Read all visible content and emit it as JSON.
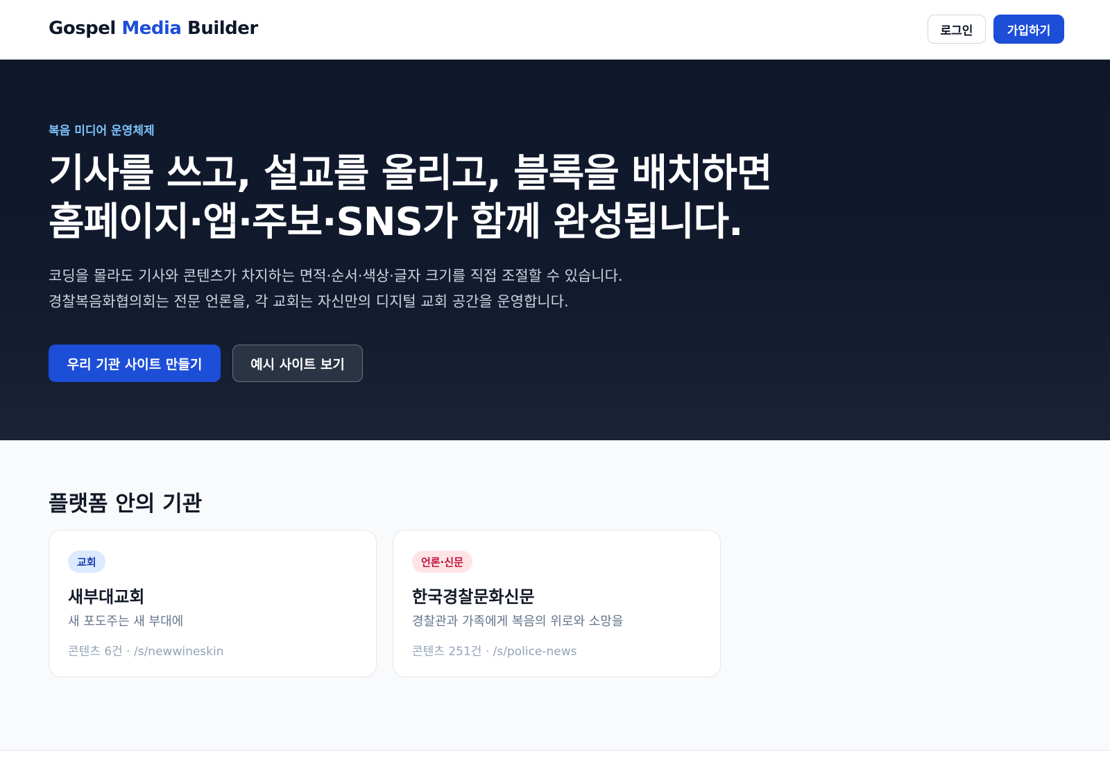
{
  "header": {
    "logo": {
      "part1": "Gospel ",
      "part2": "Media",
      "part3": " Builder"
    },
    "login_label": "로그인",
    "signup_label": "가입하기"
  },
  "hero": {
    "eyebrow": "복음 미디어 운영체제",
    "title_line1": "기사를 쓰고, 설교를 올리고, 블록을 배치하면",
    "title_line2": "홈페이지·앱·주보·SNS가 함께 완성됩니다.",
    "subtitle_line1": "코딩을 몰라도 기사와 콘텐츠가 차지하는 면적·순서·색상·글자 크기를 직접 조절할 수 있습니다.",
    "subtitle_line2": "경찰복음화협의회는 전문 언론을, 각 교회는 자신만의 디지털 교회 공간을 운영합니다.",
    "primary_cta": "우리 기관 사이트 만들기",
    "secondary_cta": "예시 사이트 보기"
  },
  "orgs": {
    "title": "플랫폼 안의 기관",
    "cards": [
      {
        "badge": "교회",
        "name": "새부대교회",
        "description": "새 포도주는 새 부대에",
        "meta": "콘텐츠 6건 · /s/newwineskin"
      },
      {
        "badge": "언론·신문",
        "name": "한국경찰문화신문",
        "description": "경찰관과 가족에게 복음의 위로와 소망을",
        "meta": "콘텐츠 251건 · /s/police-news"
      }
    ]
  },
  "colors": {
    "brand": "#1d4ed8",
    "hero_bg": "#0f172a",
    "eyebrow": "#7cc4fa",
    "church_badge_bg": "#dbeafe",
    "church_badge_text": "#1e40af",
    "press_badge_bg": "#ffe4e6",
    "press_badge_text": "#be123c"
  }
}
